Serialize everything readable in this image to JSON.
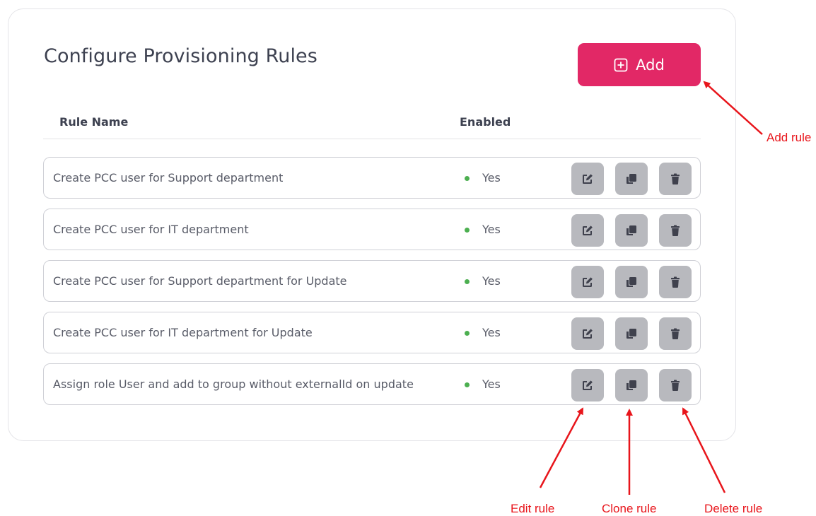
{
  "page": {
    "title": "Configure Provisioning Rules",
    "add_button": {
      "label": "Add",
      "icon": "plus-square-icon"
    },
    "columns": {
      "name": "Rule Name",
      "enabled": "Enabled"
    }
  },
  "rules": [
    {
      "name": "Create PCC user for Support department",
      "enabled": "Yes"
    },
    {
      "name": "Create PCC user for IT department",
      "enabled": "Yes"
    },
    {
      "name": "Create PCC user for Support department for Update",
      "enabled": "Yes"
    },
    {
      "name": "Create PCC user for IT department for Update",
      "enabled": "Yes"
    },
    {
      "name": "Assign role User and add to group without externalId on update",
      "enabled": "Yes"
    }
  ],
  "row_actions": [
    "edit-icon",
    "clone-icon",
    "delete-icon"
  ],
  "annotations": {
    "add": "Add rule",
    "edit": "Edit rule",
    "clone": "Clone rule",
    "delete": "Delete rule"
  },
  "colors": {
    "accent": "#e22866",
    "status_on": "#4caf50",
    "action_bg": "#b8b9be",
    "action_icon": "#3f414d",
    "annotation": "#e8151b"
  }
}
